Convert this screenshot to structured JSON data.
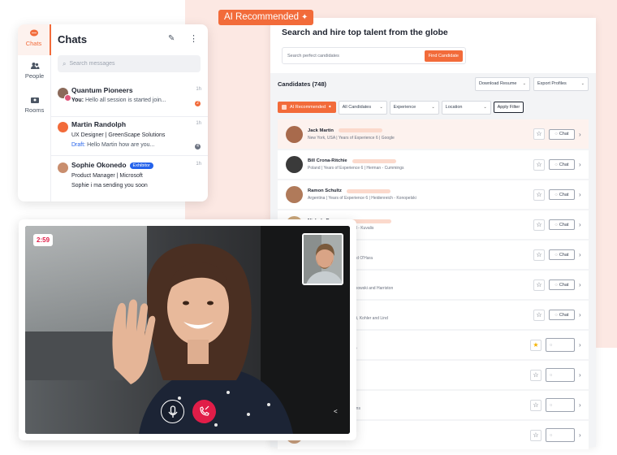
{
  "ai_tag": {
    "label": "AI Recommended",
    "icon": "sparkle-icon"
  },
  "recruiter": {
    "title": "Search and hire top talent from the globe",
    "search_placeholder": "Search perfect candidates",
    "find_button": "Find Candidate",
    "candidates_header": "Candidates (748)",
    "download_resume": "Download Resume",
    "export_profiles": "Export Profiles",
    "filters": {
      "ai_recommended": "AI Recommended",
      "all_candidates": "All Candidates",
      "experience": "Experience",
      "location": "Location",
      "apply": "Apply Filter"
    },
    "chat_label": "Chat",
    "candidates": [
      {
        "name": "Jack Martin",
        "meta": "New York, USA  |  Years of Experience 6  |  Google",
        "starred": false
      },
      {
        "name": "Bill Crona-Ritchie",
        "meta": "Poland  |  Years of Experience 6  |  Herman - Cummings",
        "starred": false
      },
      {
        "name": "Ramon Schultz",
        "meta": "Argentina  |  Years of Experience 6  |  Heidenreich - Konopelski",
        "starred": false
      },
      {
        "name": "Nichole Raynor",
        "meta": "of Experience 6  |  Schimmel - Kuvalis",
        "starred": false
      },
      {
        "name": "",
        "meta": "ence 6  |  O'Reilly, Pfeffer and O'Hara",
        "starred": false
      },
      {
        "name": "",
        "meta": "ence 6  |  Swaniawski, Jakubowski and Harriston",
        "starred": false
      },
      {
        "name": "",
        "meta": "rs of Experience 6  |  Schmitt, Kohler and Lind",
        "starred": false
      },
      {
        "name": "",
        "meta": "Experience 6  |  Hahn Group",
        "starred": true
      },
      {
        "name": "",
        "meta": "ence 6  |  Crooks LLC",
        "starred": false
      },
      {
        "name": "",
        "meta": "ence 6  |  Powlowski and Sons",
        "starred": false
      },
      {
        "name": "",
        "meta": "ence 6  |  Torp and Sons",
        "starred": false
      }
    ]
  },
  "chats": {
    "title": "Chats",
    "search_placeholder": "Search messages",
    "nav": [
      {
        "label": "Chats",
        "icon": "chat-bubble-icon"
      },
      {
        "label": "People",
        "icon": "people-icon"
      },
      {
        "label": "Rooms",
        "icon": "rooms-icon"
      }
    ],
    "items": [
      {
        "name": "Quantum Pioneers",
        "time": "1h",
        "line1_prefix": "You:",
        "line1": "Hello all session is started join...",
        "badge": "2"
      },
      {
        "name": "Martin Randolph",
        "time": "1h",
        "subtitle": "UX Designer | GreenScape Solutions",
        "line2_prefix": "Draft:",
        "line2": "Hello Martin how are you...",
        "badge": "4"
      },
      {
        "name": "Sophie Okonedo",
        "tag": "Exhibitor",
        "time": "1h",
        "subtitle": "Product Manager  | Microsoft",
        "line2": "Sophie i ma sending you soon"
      }
    ]
  },
  "video": {
    "timer": "2:59"
  },
  "colors": {
    "accent": "#f26b3a",
    "end_call": "#e11d48",
    "exhibitor": "#2563eb",
    "draft": "#2563eb"
  }
}
